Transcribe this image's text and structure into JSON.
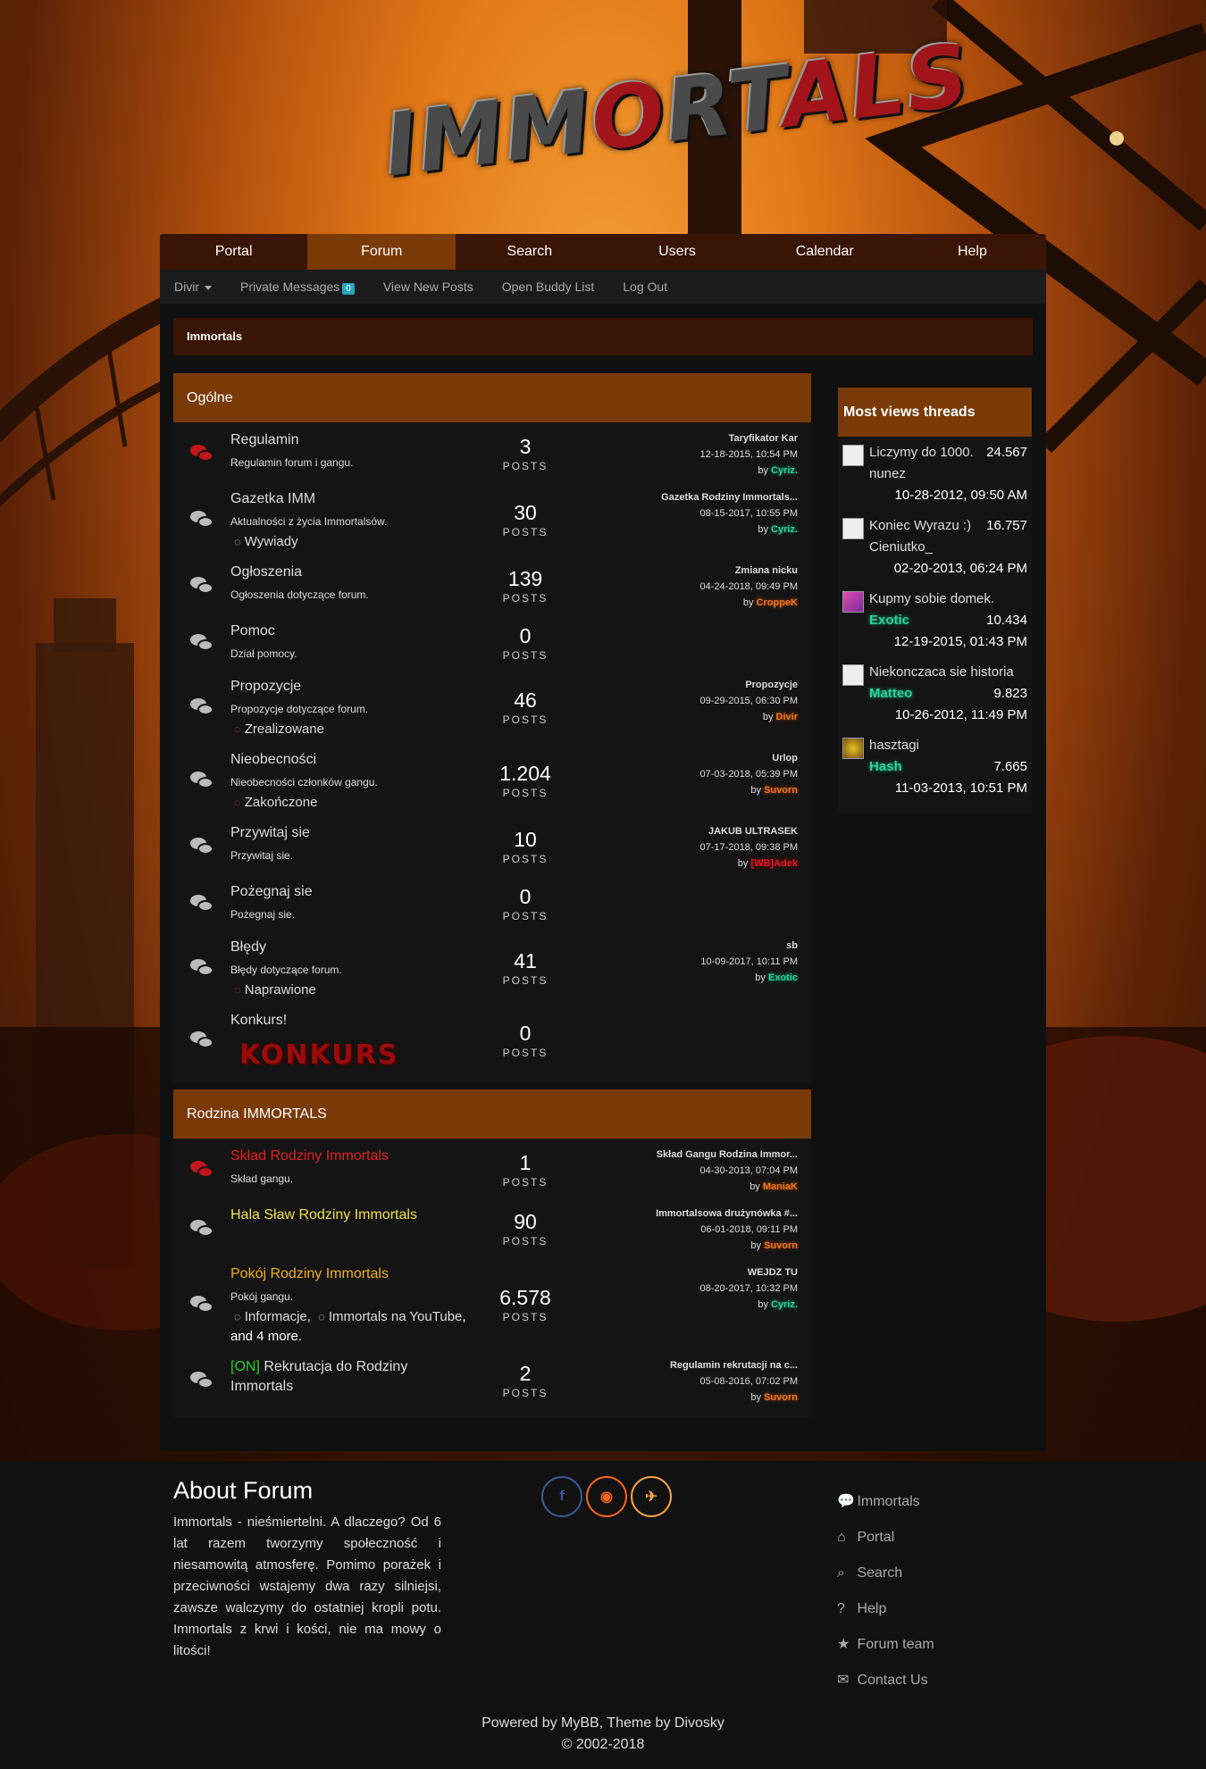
{
  "logo": {
    "part1": "IMM",
    "part2": "O",
    "part3": "RT",
    "part4": "ALS"
  },
  "nav": {
    "items": [
      "Portal",
      "Forum",
      "Search",
      "Users",
      "Calendar",
      "Help"
    ],
    "active": "Forum"
  },
  "subnav": {
    "user": "Divir",
    "private_messages": "Private Messages",
    "pm_count": "0",
    "view_new_posts": "View New Posts",
    "buddy_list": "Open Buddy List",
    "logout": "Log Out"
  },
  "breadcrumb": "Immortals",
  "categories": [
    {
      "title": "Ogólne",
      "forums": [
        {
          "title": "Regulamin",
          "desc": "Regulamin forum i gangu.",
          "posts": "3",
          "icon": "red",
          "last_title": "Taryfikator Kar",
          "last_date": "12-18-2015, 10:54 PM",
          "last_by": "Cyriz.",
          "by_color": "green"
        },
        {
          "title": "Gazetka IMM",
          "desc": "Aktualności z życia Immortalsów.",
          "sub": "Wywiady",
          "sub_icon": "grey",
          "posts": "30",
          "icon": "grey",
          "last_title": "Gazetka Rodziny Immortals...",
          "last_date": "08-15-2017, 10:55 PM",
          "last_by": "Cyriz.",
          "by_color": "green"
        },
        {
          "title": "Ogłoszenia",
          "desc": "Ogłoszenia dotyczące forum.",
          "posts": "139",
          "icon": "grey",
          "last_title": "Zmiana nicku",
          "last_date": "04-24-2018, 09:49 PM",
          "last_by": "CroppeK",
          "by_color": "orange"
        },
        {
          "title": "Pomoc",
          "desc": "Dział pomocy.",
          "posts": "0",
          "icon": "grey"
        },
        {
          "title": "Propozycje",
          "desc": "Propozycje dotyczące forum.",
          "sub": "Zrealizowane",
          "sub_icon": "red",
          "posts": "46",
          "icon": "grey",
          "last_title": "Propozycje",
          "last_date": "09-29-2015, 06:30 PM",
          "last_by": "Divir",
          "by_color": "orange"
        },
        {
          "title": "Nieobecności",
          "desc": "Nieobecności członków gangu.",
          "sub": "Zakończone",
          "sub_icon": "red",
          "posts": "1.204",
          "icon": "grey",
          "last_title": "Urlop",
          "last_date": "07-03-2018, 05:39 PM",
          "last_by": "Suvorn",
          "by_color": "orange"
        },
        {
          "title": "Przywitaj sie",
          "desc": "Przywitaj sie.",
          "posts": "10",
          "icon": "grey",
          "last_title": "JAKUB ULTRASEK",
          "last_date": "07-17-2018, 09:38 PM",
          "last_by": "[WB]Adek",
          "by_color": "red"
        },
        {
          "title": "Pożegnaj sie",
          "desc": "Pożegnaj sie.",
          "posts": "0",
          "icon": "grey"
        },
        {
          "title": "Błędy",
          "desc": "Błędy dotyczące forum.",
          "sub": "Naprawione",
          "sub_icon": "red",
          "posts": "41",
          "icon": "grey",
          "last_title": "sb",
          "last_date": "10-09-2017, 10:11 PM",
          "last_by": "Exotic",
          "by_color": "green"
        },
        {
          "title": "Konkurs!",
          "banner": "KONKURS",
          "posts": "0",
          "icon": "grey"
        }
      ]
    },
    {
      "title": "Rodzina IMMORTALS",
      "forums": [
        {
          "title": "Skład Rodziny Immortals",
          "title_color": "#e32020",
          "desc": "Skład gangu.",
          "posts": "1",
          "icon": "red",
          "last_title": "Skład Gangu Rodzina Immor...",
          "last_date": "04-30-2013, 07:04 PM",
          "last_by": "ManiaK",
          "by_color": "orange"
        },
        {
          "title": "Hala Sław Rodziny Immortals",
          "title_color": "#f1e24a",
          "posts": "90",
          "icon": "grey",
          "last_title": "Immortalsowa drużynówka #...",
          "last_date": "06-01-2018, 09:11 PM",
          "last_by": "Suvorn",
          "by_color": "orange"
        },
        {
          "title": "Pokój Rodziny Immortals",
          "title_color": "#f1b21a",
          "desc": "Pokój gangu.",
          "subs_html": true,
          "sub1": "Informacje",
          "sub2": "Immortals na YouTube",
          "more": ", and 4 more.",
          "posts": "6.578",
          "icon": "grey",
          "last_title": "WEJDZ TU",
          "last_date": "08-20-2017, 10:32 PM",
          "last_by": "Cyriz.",
          "by_color": "green"
        },
        {
          "title_prefix": "[ON]",
          "title": "Rekrutacja do Rodziny Immortals",
          "posts": "2",
          "icon": "grey",
          "last_title": "Regulamin rekrutacji na c...",
          "last_date": "05-08-2016, 07:02 PM",
          "last_by": "Suvorn",
          "by_color": "orange"
        }
      ]
    }
  ],
  "posts_label": "POSTS",
  "by_label": "by",
  "sidebar": {
    "title": "Most views threads",
    "threads": [
      {
        "title": "Liczymy do 1000.",
        "user": "nunez",
        "views": "24.567",
        "date": "10-28-2012, 09:50 AM",
        "avatar": "blank",
        "user_style": "plain"
      },
      {
        "title": "Koniec Wyrazu :)",
        "user": "Cieniutko_",
        "views": "16.757",
        "date": "02-20-2013, 06:24 PM",
        "avatar": "blank",
        "user_style": "plain"
      },
      {
        "title": "Kupmy sobie domek.",
        "user": "Exotic",
        "views": "10.434",
        "date": "12-19-2015, 01:43 PM",
        "avatar": "exotic",
        "user_style": "green"
      },
      {
        "title": "Niekonczaca sie historia",
        "user": "Matteo",
        "views": "9.823",
        "date": "10-26-2012, 11:49 PM",
        "avatar": "blank",
        "user_style": "green"
      },
      {
        "title": "hasztagi",
        "user": "Hash",
        "views": "7.665",
        "date": "11-03-2013, 10:51 PM",
        "avatar": "hash",
        "user_style": "green"
      }
    ]
  },
  "footer": {
    "about_title": "About Forum",
    "about_text": "Immortals - nieśmiertelni. A dlaczego? Od 6 lat razem tworzymy społeczność i niesamowitą atmosferę. Pomimo porażek i przeciwności wstajemy dwa razy silniejsi, zawsze walczymy do ostatniej kropli potu. Immortals z krwi i kości, nie ma mowy o litości!",
    "links": [
      "Immortals",
      "Portal",
      "Search",
      "Help",
      "Forum team",
      "Contact Us"
    ],
    "powered": "Powered by MyBB, Theme by Divosky",
    "copyright": "© 2002-2018"
  }
}
